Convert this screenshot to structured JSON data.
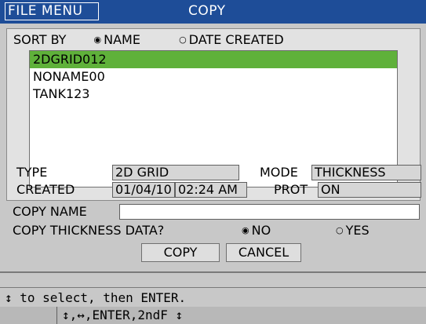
{
  "header": {
    "menu_label": "FILE MENU",
    "title": "COPY"
  },
  "sort": {
    "label": "SORT BY",
    "options": [
      {
        "label": "NAME",
        "selected": true
      },
      {
        "label": "DATE CREATED",
        "selected": false
      }
    ],
    "radio_on": "◉",
    "radio_off": "○"
  },
  "files": [
    {
      "name": "2DGRID012",
      "selected": true
    },
    {
      "name": "NONAME00",
      "selected": false
    },
    {
      "name": "TANK123",
      "selected": false
    }
  ],
  "info": {
    "type_label": "TYPE",
    "type_value": "2D GRID",
    "mode_label": "MODE",
    "mode_value": "THICKNESS",
    "created_label": "CREATED",
    "created_date": "01/04/10",
    "created_time": "02:24 AM",
    "prot_label": "PROT",
    "prot_value": "ON"
  },
  "copy_form": {
    "name_label": "COPY NAME",
    "name_value": "",
    "data_label": "COPY THICKNESS DATA?",
    "no_label": "NO",
    "yes_label": "YES",
    "no_selected": true,
    "copy_button": "COPY",
    "cancel_button": "CANCEL"
  },
  "status": {
    "message": "↕ to select, then ENTER.",
    "key_hint": "↕,↔,ENTER,2ndF ↕"
  },
  "colors": {
    "title_bar": "#1e4d98",
    "selection": "#5fb13a",
    "background": "#c8c8c8"
  }
}
